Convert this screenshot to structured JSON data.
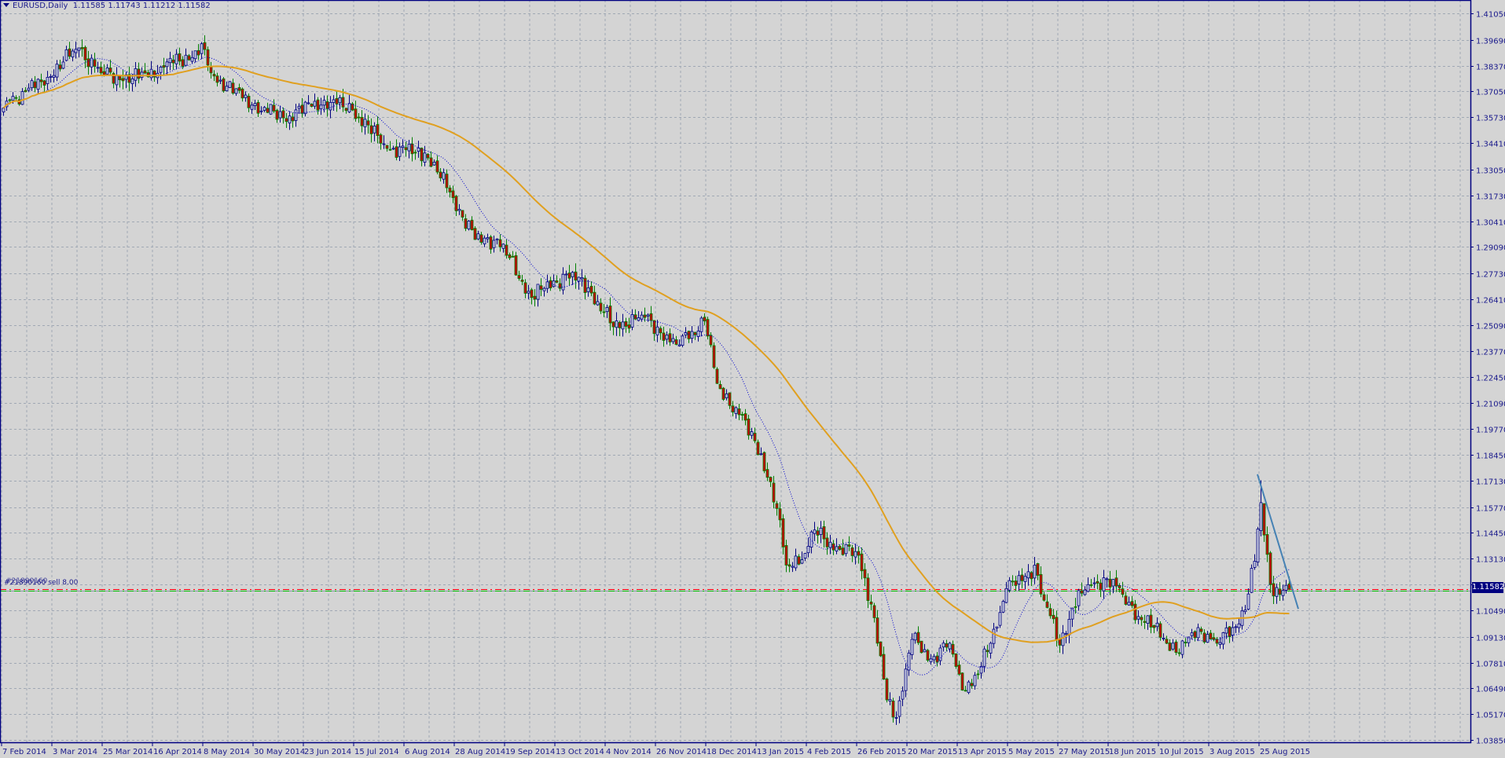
{
  "header": {
    "symbol": "EURUSD,Daily",
    "ohlc": "1.11585 1.11743 1.11212 1.11582"
  },
  "current_price": "1.11582",
  "orders": [
    {
      "label": "#21890160 sell 8.00"
    },
    {
      "label": "#21890160"
    }
  ],
  "colors": {
    "background": "#d4d4d4",
    "axis": "#000080",
    "grid": "#a0a8b4",
    "bull": "#000080",
    "bull_fill": "#c9cde0",
    "bear": "#008000",
    "bear_fill": "#cc0000",
    "ma_fast": "#0000cc",
    "ma_slow": "#e0a020",
    "trendline": "#4682b4",
    "order_line": "#ff0000",
    "order_tp": "#00c000"
  },
  "chart_data": {
    "type": "candlestick",
    "title": "EURUSD,Daily",
    "ylim": [
      1.0385,
      1.4105
    ],
    "y_ticks": [
      "1.41050",
      "1.39690",
      "1.38370",
      "1.37050",
      "1.35730",
      "1.34410",
      "1.33050",
      "1.31730",
      "1.30410",
      "1.29090",
      "1.27730",
      "1.26410",
      "1.25090",
      "1.23770",
      "1.22450",
      "1.21090",
      "1.19770",
      "1.18450",
      "1.17130",
      "1.15770",
      "1.14450",
      "1.13130",
      "1.11810",
      "1.10490",
      "1.09130",
      "1.07810",
      "1.06490",
      "1.05170",
      "1.03850"
    ],
    "x_ticks": [
      "7 Feb 2014",
      "3 Mar 2014",
      "25 Mar 2014",
      "16 Apr 2014",
      "8 May 2014",
      "30 May 2014",
      "23 Jun 2014",
      "15 Jul 2014",
      "6 Aug 2014",
      "28 Aug 2014",
      "19 Sep 2014",
      "13 Oct 2014",
      "4 Nov 2014",
      "26 Nov 2014",
      "18 Dec 2014",
      "13 Jan 2015",
      "4 Feb 2015",
      "26 Feb 2015",
      "20 Mar 2015",
      "13 Apr 2015",
      "5 May 2015",
      "27 May 2015",
      "18 Jun 2015",
      "10 Jul 2015",
      "3 Aug 2015",
      "25 Aug 2015"
    ],
    "bars_per_x_tick": 16,
    "bar_count": 410,
    "close_anchors": [
      [
        0,
        1.362
      ],
      [
        2,
        1.3659
      ],
      [
        12,
        1.3755
      ],
      [
        24,
        1.3928
      ],
      [
        31,
        1.38
      ],
      [
        41,
        1.377
      ],
      [
        50,
        1.383
      ],
      [
        64,
        1.392
      ],
      [
        66,
        1.38
      ],
      [
        79,
        1.3635
      ],
      [
        89,
        1.357
      ],
      [
        102,
        1.366
      ],
      [
        111,
        1.361
      ],
      [
        122,
        1.3413
      ],
      [
        134,
        1.339
      ],
      [
        142,
        1.319
      ],
      [
        150,
        1.2947
      ],
      [
        157,
        1.295
      ],
      [
        168,
        1.265
      ],
      [
        179,
        1.277
      ],
      [
        186,
        1.27
      ],
      [
        194,
        1.25
      ],
      [
        203,
        1.256
      ],
      [
        214,
        1.241
      ],
      [
        223,
        1.253
      ],
      [
        227,
        1.221
      ],
      [
        234,
        1.205
      ],
      [
        241,
        1.185
      ],
      [
        246,
        1.157
      ],
      [
        249,
        1.128
      ],
      [
        255,
        1.134
      ],
      [
        258,
        1.146
      ],
      [
        266,
        1.136
      ],
      [
        272,
        1.133
      ],
      [
        276,
        1.108
      ],
      [
        281,
        1.059
      ],
      [
        284,
        1.05
      ],
      [
        289,
        1.09
      ],
      [
        295,
        1.08
      ],
      [
        301,
        1.088
      ],
      [
        305,
        1.064
      ],
      [
        310,
        1.072
      ],
      [
        314,
        1.088
      ],
      [
        319,
        1.116
      ],
      [
        324,
        1.12
      ],
      [
        328,
        1.128
      ],
      [
        331,
        1.11
      ],
      [
        336,
        1.087
      ],
      [
        340,
        1.106
      ],
      [
        345,
        1.118
      ],
      [
        351,
        1.121
      ],
      [
        356,
        1.113
      ],
      [
        362,
        1.1
      ],
      [
        366,
        1.096
      ],
      [
        374,
        1.083
      ],
      [
        380,
        1.096
      ],
      [
        386,
        1.088
      ],
      [
        391,
        1.096
      ],
      [
        395,
        1.105
      ],
      [
        398,
        1.13
      ],
      [
        400,
        1.16
      ],
      [
        403,
        1.118
      ],
      [
        406,
        1.113
      ],
      [
        409,
        1.11582
      ]
    ],
    "extremes": {
      "high": [
        [
          64,
          1.3993
        ],
        [
          400,
          1.1714
        ]
      ],
      "low": [
        [
          284,
          1.0462
        ]
      ]
    },
    "indicators": [
      {
        "name": "MA fast",
        "period": 14,
        "style": "dotted"
      },
      {
        "name": "MA slow",
        "period": 55,
        "style": "solid"
      }
    ],
    "order_price": 1.11582,
    "trendline": [
      [
        399,
        1.1745
      ],
      [
        412,
        1.1056
      ]
    ]
  }
}
